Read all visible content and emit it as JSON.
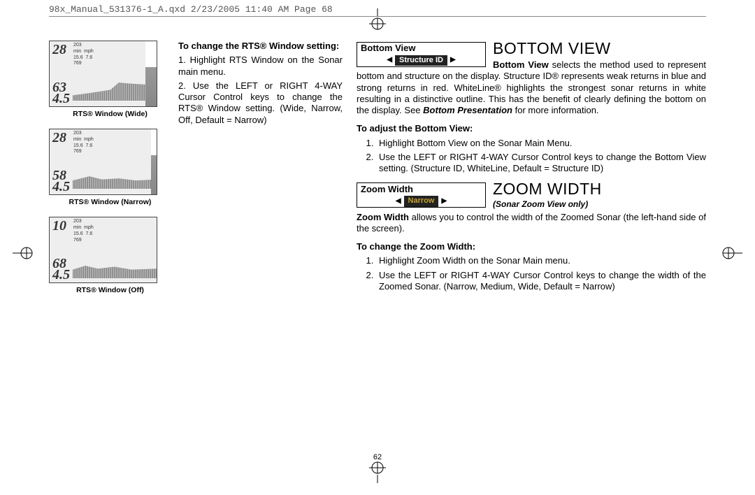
{
  "header": {
    "slug": "98x_Manual_531376-1_A.qxd  2/23/2005  11:40 AM  Page 68"
  },
  "pageNumber": "62",
  "thumbs": {
    "wide": {
      "nums": [
        "28",
        "63",
        "4.5"
      ],
      "side": "203\nmin  mph\n15.6  7.6\n769",
      "caption": "RTS® Window (Wide)"
    },
    "narrow": {
      "nums": [
        "28",
        "58",
        "4.5"
      ],
      "side": "203\nmin  mph\n15.6  7.6\n769",
      "caption": "RTS® Window (Narrow)"
    },
    "off": {
      "nums": [
        "10",
        "68",
        "4.5"
      ],
      "side": "203\nmin  mph\n15.6  7.6\n769",
      "caption": "RTS® Window (Off)"
    }
  },
  "rts": {
    "heading": "To change the RTS® Window setting:",
    "step1": "1. Highlight RTS Window on the Sonar main menu.",
    "step2": "2. Use the LEFT or RIGHT 4-WAY Cursor Control keys to change the RTS® Window setting. (Wide, Narrow, Off, Default = Narrow)"
  },
  "bottomView": {
    "chipLabel": "Bottom View",
    "chipValue": "Structure ID",
    "title": "BOTTOM VIEW",
    "lead": "Bottom View",
    "body": " selects the method used to represent bottom and structure on the display. Structure ID® represents weak returns in blue and strong returns in red. WhiteLine® highlights the strongest sonar returns in white resulting in a distinctive outline. This has the benefit of clearly defining the bottom on the display. See ",
    "bodyEmph": "Bottom Presentation",
    "bodyTail": " for more information.",
    "adjustHeading": "To adjust the Bottom View:",
    "step1": "Highlight Bottom View on the Sonar Main Menu.",
    "step2": "Use the LEFT or RIGHT 4-WAY Cursor Control keys to change the Bottom View setting. (Structure ID, WhiteLine, Default = Structure ID)"
  },
  "zoomWidth": {
    "chipLabel": "Zoom Width",
    "chipValue": "Narrow",
    "title": "ZOOM WIDTH",
    "subtitle": "(Sonar Zoom View only)",
    "lead": "Zoom Width",
    "body": " allows you to control the width of the Zoomed Sonar (the left-hand side of the screen).",
    "changeHeading": "To change the Zoom Width:",
    "step1": "Highlight Zoom Width on the Sonar Main menu.",
    "step2": "Use the LEFT or RIGHT 4-WAY Cursor Control keys to change the width of the Zoomed Sonar. (Narrow, Medium, Wide, Default = Narrow)"
  }
}
